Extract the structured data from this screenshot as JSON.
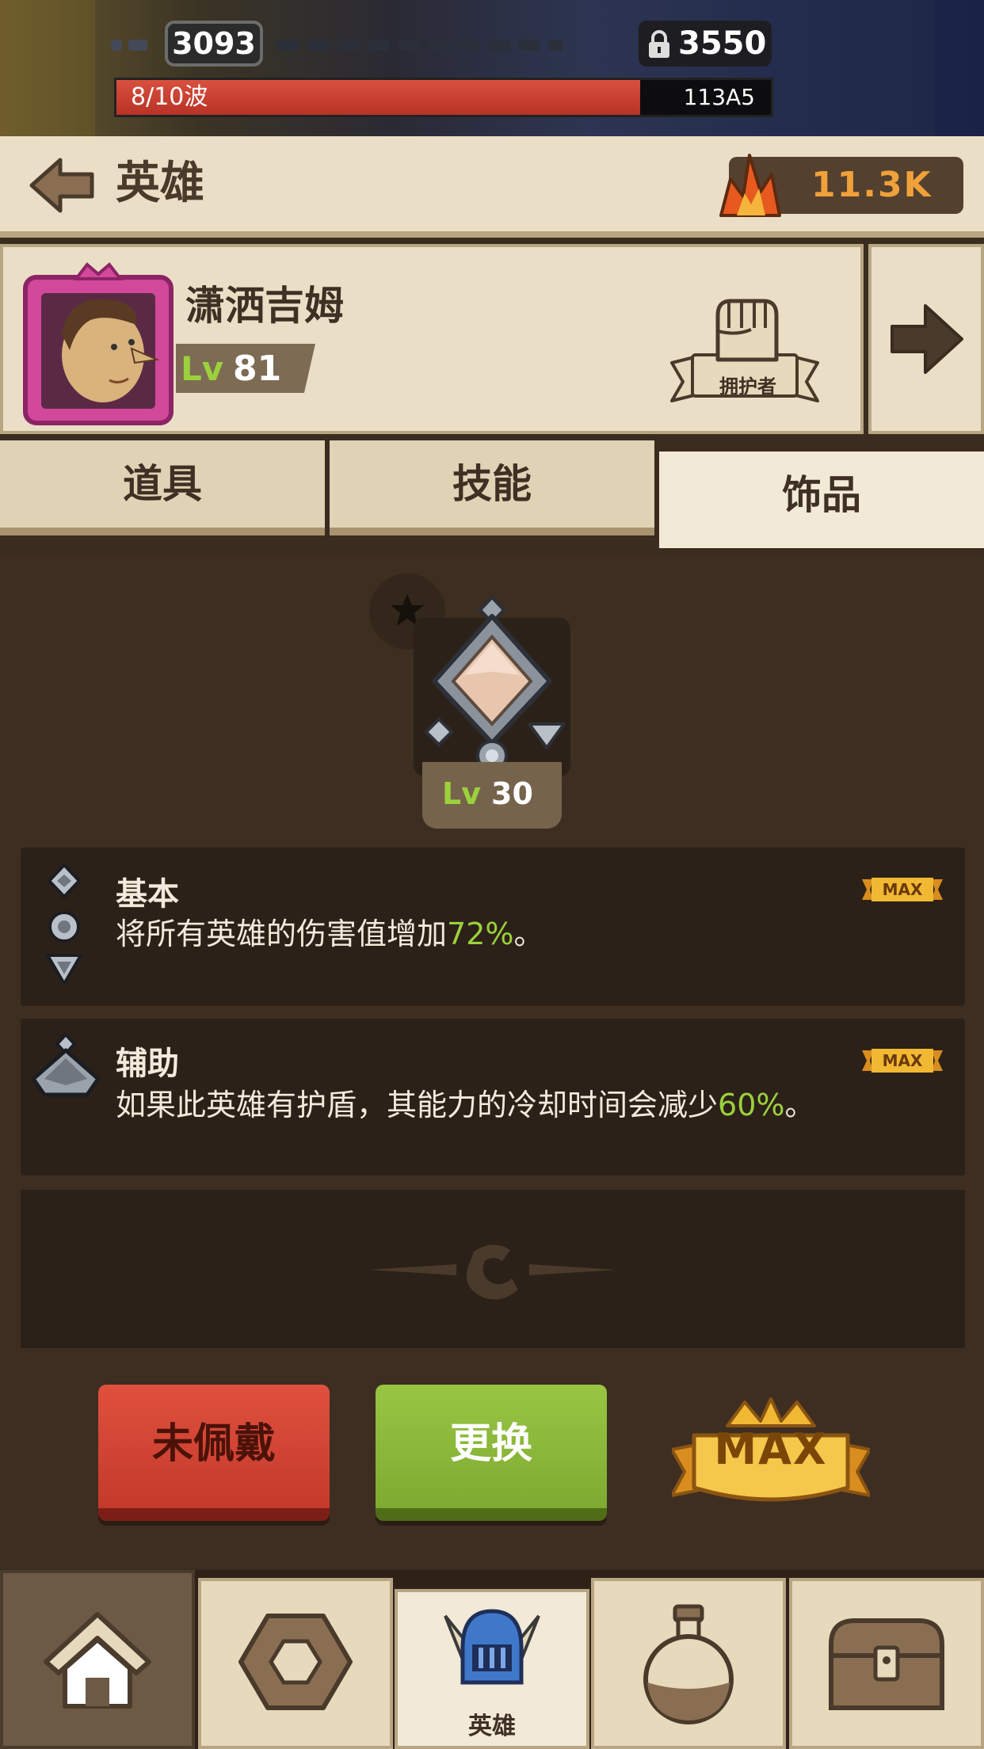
{
  "top_bar": {
    "score": "3093",
    "locked_value": "3550",
    "wave_label": "8/10波",
    "wave_progress": 0.8,
    "wave_id": "113A5"
  },
  "header": {
    "title": "英雄",
    "crystals": "11.3K"
  },
  "hero": {
    "name": "潇洒吉姆",
    "level_prefix": "Lv",
    "level": "81",
    "class_label": "拥护者"
  },
  "tabs": [
    {
      "label": "道具",
      "active": false
    },
    {
      "label": "技能",
      "active": false
    },
    {
      "label": "饰品",
      "active": true
    }
  ],
  "trinket": {
    "level_prefix": "Lv",
    "level": "30"
  },
  "effects": [
    {
      "title": "基本",
      "desc_before": "将所有英雄的伤害值增加",
      "value": "72%",
      "desc_after": "。",
      "badge": "MAX"
    },
    {
      "title": "辅助",
      "desc_before": "如果此英雄有护盾，其能力的冷却时间会减少",
      "value": "60%",
      "desc_after": "。",
      "badge": "MAX"
    }
  ],
  "actions": {
    "unequip_label": "未佩戴",
    "swap_label": "更换",
    "max_label": "MAX"
  },
  "bottom_nav": [
    {
      "icon": "home-icon"
    },
    {
      "icon": "gear-nut-icon"
    },
    {
      "icon": "knight-helmet-icon",
      "label": "英雄"
    },
    {
      "icon": "potion-icon"
    },
    {
      "icon": "treasure-chest-icon"
    }
  ],
  "colors": {
    "accent_green": "#9bd13c",
    "wave_red": "#c43a2a",
    "crystal_orange": "#f0a13a",
    "panel_brown": "#3d2e21",
    "parchment": "#eadfc6"
  }
}
